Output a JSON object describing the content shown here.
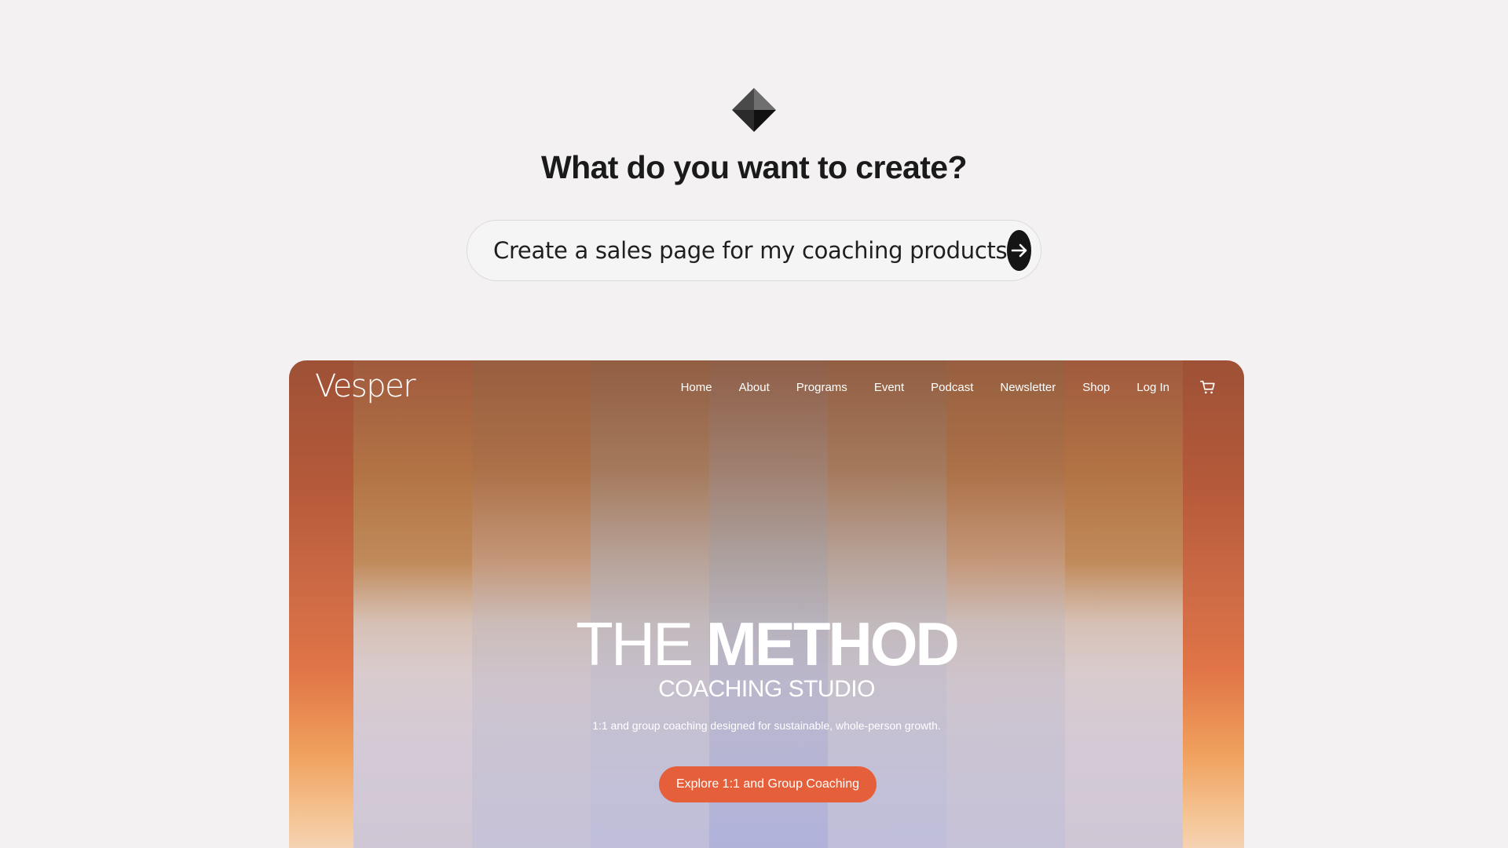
{
  "builder": {
    "heading": "What do you want to create?",
    "prompt_value": "Create a sales page for my coaching products",
    "submit_icon": "arrow-right-icon",
    "logo_icon": "diamond-logo-icon"
  },
  "preview": {
    "site_name": "Vesper",
    "nav": [
      "Home",
      "About",
      "Programs",
      "Event",
      "Podcast",
      "Newsletter",
      "Shop",
      "Log In"
    ],
    "cart_icon": "cart-icon",
    "hero": {
      "title_light": "THE",
      "title_bold": "METHOD",
      "subtitle": "COACHING STUDIO",
      "description": "1:1 and group coaching designed for sustainable, whole-person growth.",
      "cta": "Explore 1:1 and Group Coaching"
    },
    "colors": {
      "accent": "#e5603a",
      "page_bg": "#f3f1f2",
      "button_dark": "#151515"
    }
  }
}
